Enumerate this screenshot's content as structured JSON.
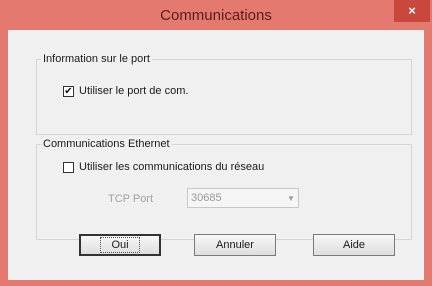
{
  "window": {
    "title": "Communications",
    "close_glyph": "×",
    "accent_color": "#e4796f"
  },
  "port_group": {
    "legend": "Information sur le port",
    "use_com_port": {
      "label": "Utiliser le port de com.",
      "checked": true,
      "check_glyph": "✔"
    }
  },
  "ethernet_group": {
    "legend": "Communications Ethernet",
    "use_network": {
      "label": "Utiliser les communications du réseau",
      "checked": false
    },
    "tcp_port": {
      "label": "TCP Port",
      "value": "30685",
      "arrow_glyph": "▼"
    }
  },
  "buttons": {
    "ok": "Oui",
    "cancel": "Annuler",
    "help": "Aide"
  }
}
